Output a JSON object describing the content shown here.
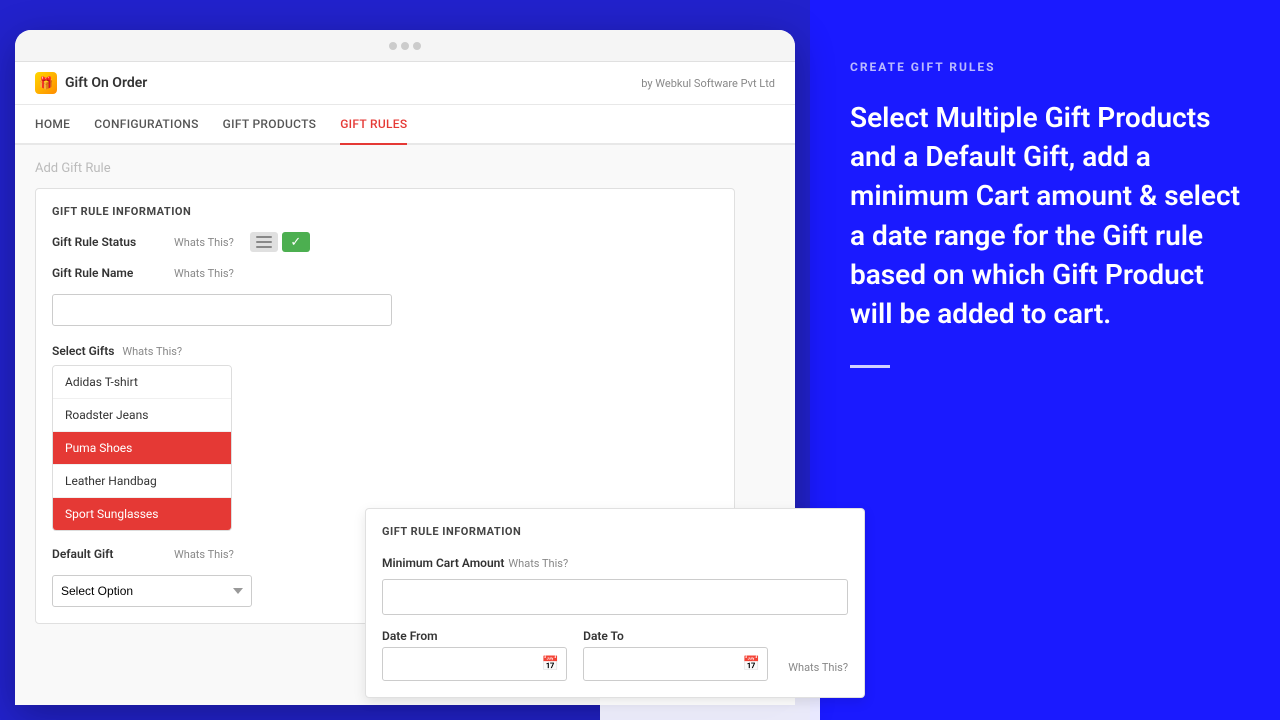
{
  "app": {
    "logo_emoji": "🎁",
    "title": "Gift On Order",
    "powered_by": "by Webkul Software Pvt Ltd"
  },
  "nav": {
    "items": [
      {
        "label": "HOME",
        "active": false
      },
      {
        "label": "CONFIGURATIONS",
        "active": false
      },
      {
        "label": "GIFT PRODUCTS",
        "active": false
      },
      {
        "label": "GIFT RULES",
        "active": true
      }
    ]
  },
  "page": {
    "breadcrumb": "Add Gift Rule",
    "section1_title": "GIFT RULE INFORMATION",
    "gift_rule_status_label": "Gift Rule Status",
    "whats_this": "Whats This?",
    "gift_rule_name_label": "Gift Rule Name",
    "select_gifts_label": "Select Gifts",
    "default_gift_label": "Default Gift",
    "select_option_placeholder": "Select Option",
    "gifts": [
      {
        "label": "Adidas T-shirt",
        "selected": false
      },
      {
        "label": "Roadster Jeans",
        "selected": false
      },
      {
        "label": "Puma Shoes",
        "selected": true
      },
      {
        "label": "Leather Handbag",
        "selected": false
      },
      {
        "label": "Sport Sunglasses",
        "selected": true
      }
    ]
  },
  "second_card": {
    "section_title": "GIFT RULE INFORMATION",
    "min_cart_amount_label": "Minimum Cart Amount",
    "whats_this": "Whats This?",
    "date_from_label": "Date From",
    "date_to_label": "Date To",
    "date_whats_this": "Whats This?"
  },
  "right_panel": {
    "label": "CREATE GIFT RULES",
    "description": "Select Multiple Gift Products and a Default Gift, add a minimum Cart amount & select a date range for the Gift rule based on which Gift Product will be added to cart."
  }
}
